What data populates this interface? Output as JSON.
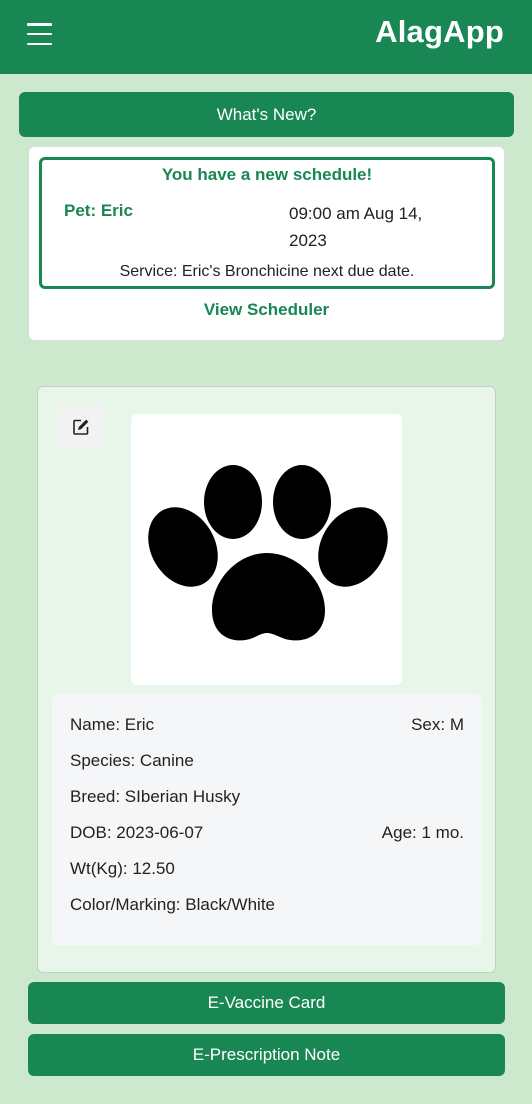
{
  "navbar": {
    "brand": "AlagApp",
    "menu_icon": "hamburger-menu-icon"
  },
  "whats_new": {
    "label": "What's New?"
  },
  "notice": {
    "title": "You have a new schedule!",
    "pet_label": "Pet: Eric",
    "datetime": "09:00 am Aug 14, 2023",
    "service": "Service: Eric's Bronchicine next due date.",
    "view_scheduler": "View Scheduler"
  },
  "pet": {
    "edit_icon": "edit-icon",
    "photo_icon": "paw-print-icon",
    "name": "Name: Eric",
    "sex": "Sex: M",
    "species": "Species: Canine",
    "breed": "Breed: SIberian Husky",
    "dob": "DOB: 2023-06-07",
    "age": "Age: 1 mo.",
    "weight": "Wt(Kg): 12.50",
    "color": "Color/Marking: Black/White"
  },
  "actions": {
    "evaccine": "E-Vaccine Card",
    "eprescription": "E-Prescription Note"
  },
  "colors": {
    "primary": "#198754",
    "background": "#cce8cd",
    "card_tint": "#e8f5e9"
  }
}
